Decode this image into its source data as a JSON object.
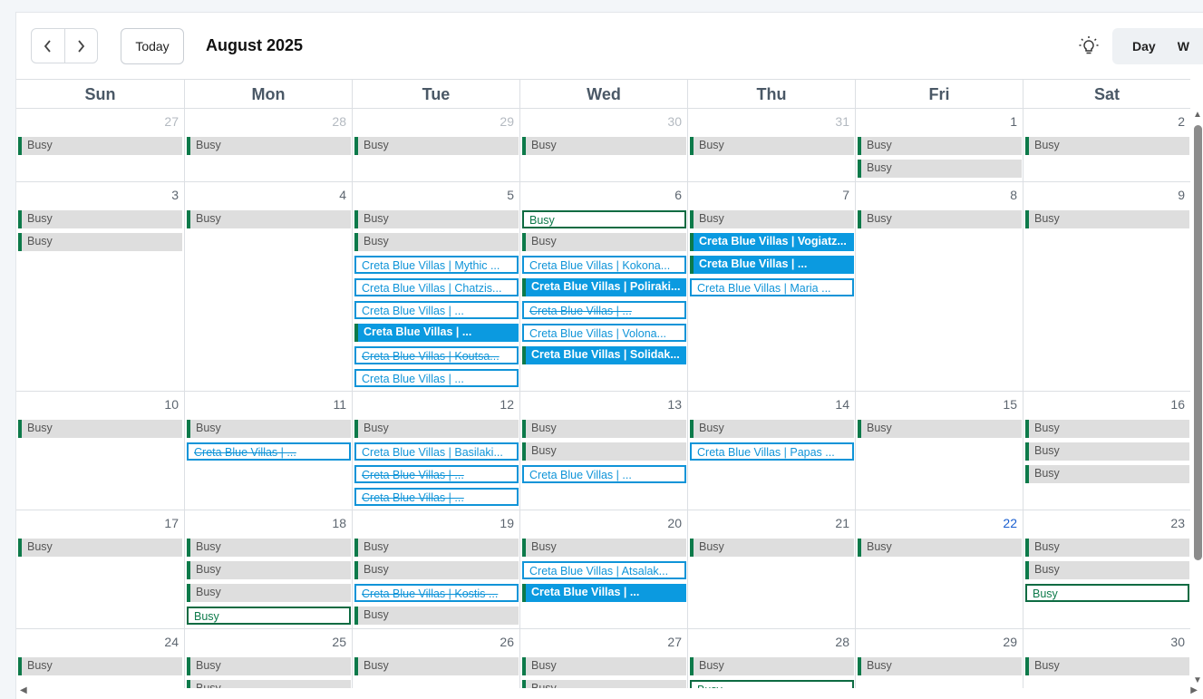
{
  "toolbar": {
    "prev_glyph": "‹",
    "next_glyph": "›",
    "today_label": "Today",
    "month_title": "August 2025",
    "theme_icon": "lightbulb-icon",
    "views": [
      "Day",
      "W"
    ]
  },
  "weekdays": [
    "Sun",
    "Mon",
    "Tue",
    "Wed",
    "Thu",
    "Fri",
    "Sat"
  ],
  "colors": {
    "busy_bg": "#dedede",
    "busy_accent": "#0d7a4a",
    "creta_blue": "#0b9ae0",
    "today_number": "#1a5fd0"
  },
  "weeks": [
    {
      "days": [
        {
          "num": "27",
          "state": "other",
          "events": [
            {
              "t": "Busy",
              "k": "busy"
            }
          ]
        },
        {
          "num": "28",
          "state": "other",
          "events": [
            {
              "t": "Busy",
              "k": "busy"
            }
          ]
        },
        {
          "num": "29",
          "state": "other",
          "events": [
            {
              "t": "Busy",
              "k": "busy"
            }
          ]
        },
        {
          "num": "30",
          "state": "other",
          "events": [
            {
              "t": "Busy",
              "k": "busy"
            }
          ]
        },
        {
          "num": "31",
          "state": "other",
          "events": [
            {
              "t": "Busy",
              "k": "busy"
            }
          ]
        },
        {
          "num": "1",
          "state": "",
          "events": [
            {
              "t": "Busy",
              "k": "busy"
            },
            {
              "t": "Busy",
              "k": "busy"
            }
          ]
        },
        {
          "num": "2",
          "state": "",
          "events": [
            {
              "t": "Busy",
              "k": "busy"
            }
          ]
        }
      ]
    },
    {
      "days": [
        {
          "num": "3",
          "state": "",
          "events": [
            {
              "t": "Busy",
              "k": "busy"
            },
            {
              "t": "Busy",
              "k": "busy"
            }
          ]
        },
        {
          "num": "4",
          "state": "",
          "events": [
            {
              "t": "Busy",
              "k": "busy"
            }
          ]
        },
        {
          "num": "5",
          "state": "",
          "events": [
            {
              "t": "Busy",
              "k": "busy"
            },
            {
              "t": "Busy",
              "k": "busy"
            },
            {
              "t": "Creta Blue Villas | Mythic ...",
              "k": "creta-o"
            },
            {
              "t": "Creta Blue Villas | Chatzis...",
              "k": "creta-o"
            },
            {
              "t": "Creta Blue Villas | ...",
              "k": "creta-o"
            },
            {
              "t": "Creta Blue Villas | ...",
              "k": "creta-f"
            },
            {
              "t": "Creta Blue Villas | Koutsa...",
              "k": "creta-o strike"
            },
            {
              "t": "Creta Blue Villas | ...",
              "k": "creta-o"
            }
          ]
        },
        {
          "num": "6",
          "state": "",
          "events": [
            {
              "t": "Busy",
              "k": "busy-o"
            },
            {
              "t": "Busy",
              "k": "busy"
            },
            {
              "t": "Creta Blue Villas | Kokona...",
              "k": "creta-o"
            },
            {
              "t": "Creta Blue Villas | Poliraki...",
              "k": "creta-f"
            },
            {
              "t": "Creta Blue Villas | ...",
              "k": "creta-o strike"
            },
            {
              "t": "Creta Blue Villas | Volona...",
              "k": "creta-o"
            },
            {
              "t": "Creta Blue Villas | Solidak...",
              "k": "creta-f"
            }
          ]
        },
        {
          "num": "7",
          "state": "",
          "events": [
            {
              "t": "Busy",
              "k": "busy"
            },
            {
              "t": "Creta Blue Villas | Vogiatz...",
              "k": "creta-f"
            },
            {
              "t": "Creta Blue Villas | ...",
              "k": "creta-f"
            },
            {
              "t": "Creta Blue Villas | Maria ...",
              "k": "creta-o"
            }
          ]
        },
        {
          "num": "8",
          "state": "",
          "events": [
            {
              "t": "Busy",
              "k": "busy"
            }
          ]
        },
        {
          "num": "9",
          "state": "",
          "events": [
            {
              "t": "Busy",
              "k": "busy"
            }
          ]
        }
      ]
    },
    {
      "days": [
        {
          "num": "10",
          "state": "",
          "events": [
            {
              "t": "Busy",
              "k": "busy"
            }
          ]
        },
        {
          "num": "11",
          "state": "",
          "events": [
            {
              "t": "Busy",
              "k": "busy"
            },
            {
              "t": "Creta Blue Villas | ...",
              "k": "creta-o strike"
            }
          ]
        },
        {
          "num": "12",
          "state": "",
          "events": [
            {
              "t": "Busy",
              "k": "busy"
            },
            {
              "t": "Creta Blue Villas | Basilaki...",
              "k": "creta-o"
            },
            {
              "t": "Creta Blue Villas | ...",
              "k": "creta-o strike"
            },
            {
              "t": "Creta Blue Villas | ...",
              "k": "creta-o strike"
            }
          ]
        },
        {
          "num": "13",
          "state": "",
          "events": [
            {
              "t": "Busy",
              "k": "busy"
            },
            {
              "t": "Busy",
              "k": "busy"
            },
            {
              "t": "Creta Blue Villas | ...",
              "k": "creta-o"
            }
          ]
        },
        {
          "num": "14",
          "state": "",
          "events": [
            {
              "t": "Busy",
              "k": "busy"
            },
            {
              "t": "Creta Blue Villas | Papas ...",
              "k": "creta-o"
            }
          ]
        },
        {
          "num": "15",
          "state": "",
          "events": [
            {
              "t": "Busy",
              "k": "busy"
            }
          ]
        },
        {
          "num": "16",
          "state": "",
          "events": [
            {
              "t": "Busy",
              "k": "busy"
            },
            {
              "t": "Busy",
              "k": "busy"
            },
            {
              "t": "Busy",
              "k": "busy"
            }
          ]
        }
      ]
    },
    {
      "days": [
        {
          "num": "17",
          "state": "",
          "events": [
            {
              "t": "Busy",
              "k": "busy"
            }
          ]
        },
        {
          "num": "18",
          "state": "",
          "events": [
            {
              "t": "Busy",
              "k": "busy"
            },
            {
              "t": "Busy",
              "k": "busy"
            },
            {
              "t": "Busy",
              "k": "busy"
            },
            {
              "t": "Busy",
              "k": "busy-o"
            }
          ]
        },
        {
          "num": "19",
          "state": "",
          "events": [
            {
              "t": "Busy",
              "k": "busy"
            },
            {
              "t": "Busy",
              "k": "busy"
            },
            {
              "t": "Creta Blue Villas | Kostis ...",
              "k": "creta-o strike"
            },
            {
              "t": "Busy",
              "k": "busy"
            }
          ]
        },
        {
          "num": "20",
          "state": "",
          "events": [
            {
              "t": "Busy",
              "k": "busy"
            },
            {
              "t": "Creta Blue Villas | Atsalak...",
              "k": "creta-o"
            },
            {
              "t": "Creta Blue Villas | ...",
              "k": "creta-f"
            }
          ]
        },
        {
          "num": "21",
          "state": "",
          "events": [
            {
              "t": "Busy",
              "k": "busy"
            }
          ]
        },
        {
          "num": "22",
          "state": "today",
          "events": [
            {
              "t": "Busy",
              "k": "busy"
            }
          ]
        },
        {
          "num": "23",
          "state": "",
          "events": [
            {
              "t": "Busy",
              "k": "busy"
            },
            {
              "t": "Busy",
              "k": "busy"
            },
            {
              "t": "Busy",
              "k": "busy-o"
            }
          ]
        }
      ]
    },
    {
      "days": [
        {
          "num": "24",
          "state": "",
          "events": [
            {
              "t": "Busy",
              "k": "busy"
            }
          ]
        },
        {
          "num": "25",
          "state": "",
          "events": [
            {
              "t": "Busy",
              "k": "busy"
            },
            {
              "t": "Busy",
              "k": "busy"
            }
          ]
        },
        {
          "num": "26",
          "state": "",
          "events": [
            {
              "t": "Busy",
              "k": "busy"
            }
          ]
        },
        {
          "num": "27",
          "state": "",
          "events": [
            {
              "t": "Busy",
              "k": "busy"
            },
            {
              "t": "Busy",
              "k": "busy"
            }
          ]
        },
        {
          "num": "28",
          "state": "",
          "events": [
            {
              "t": "Busy",
              "k": "busy"
            },
            {
              "t": "Busy",
              "k": "busy-o"
            }
          ]
        },
        {
          "num": "29",
          "state": "",
          "events": [
            {
              "t": "Busy",
              "k": "busy"
            }
          ]
        },
        {
          "num": "30",
          "state": "",
          "events": [
            {
              "t": "Busy",
              "k": "busy"
            }
          ]
        }
      ]
    }
  ]
}
